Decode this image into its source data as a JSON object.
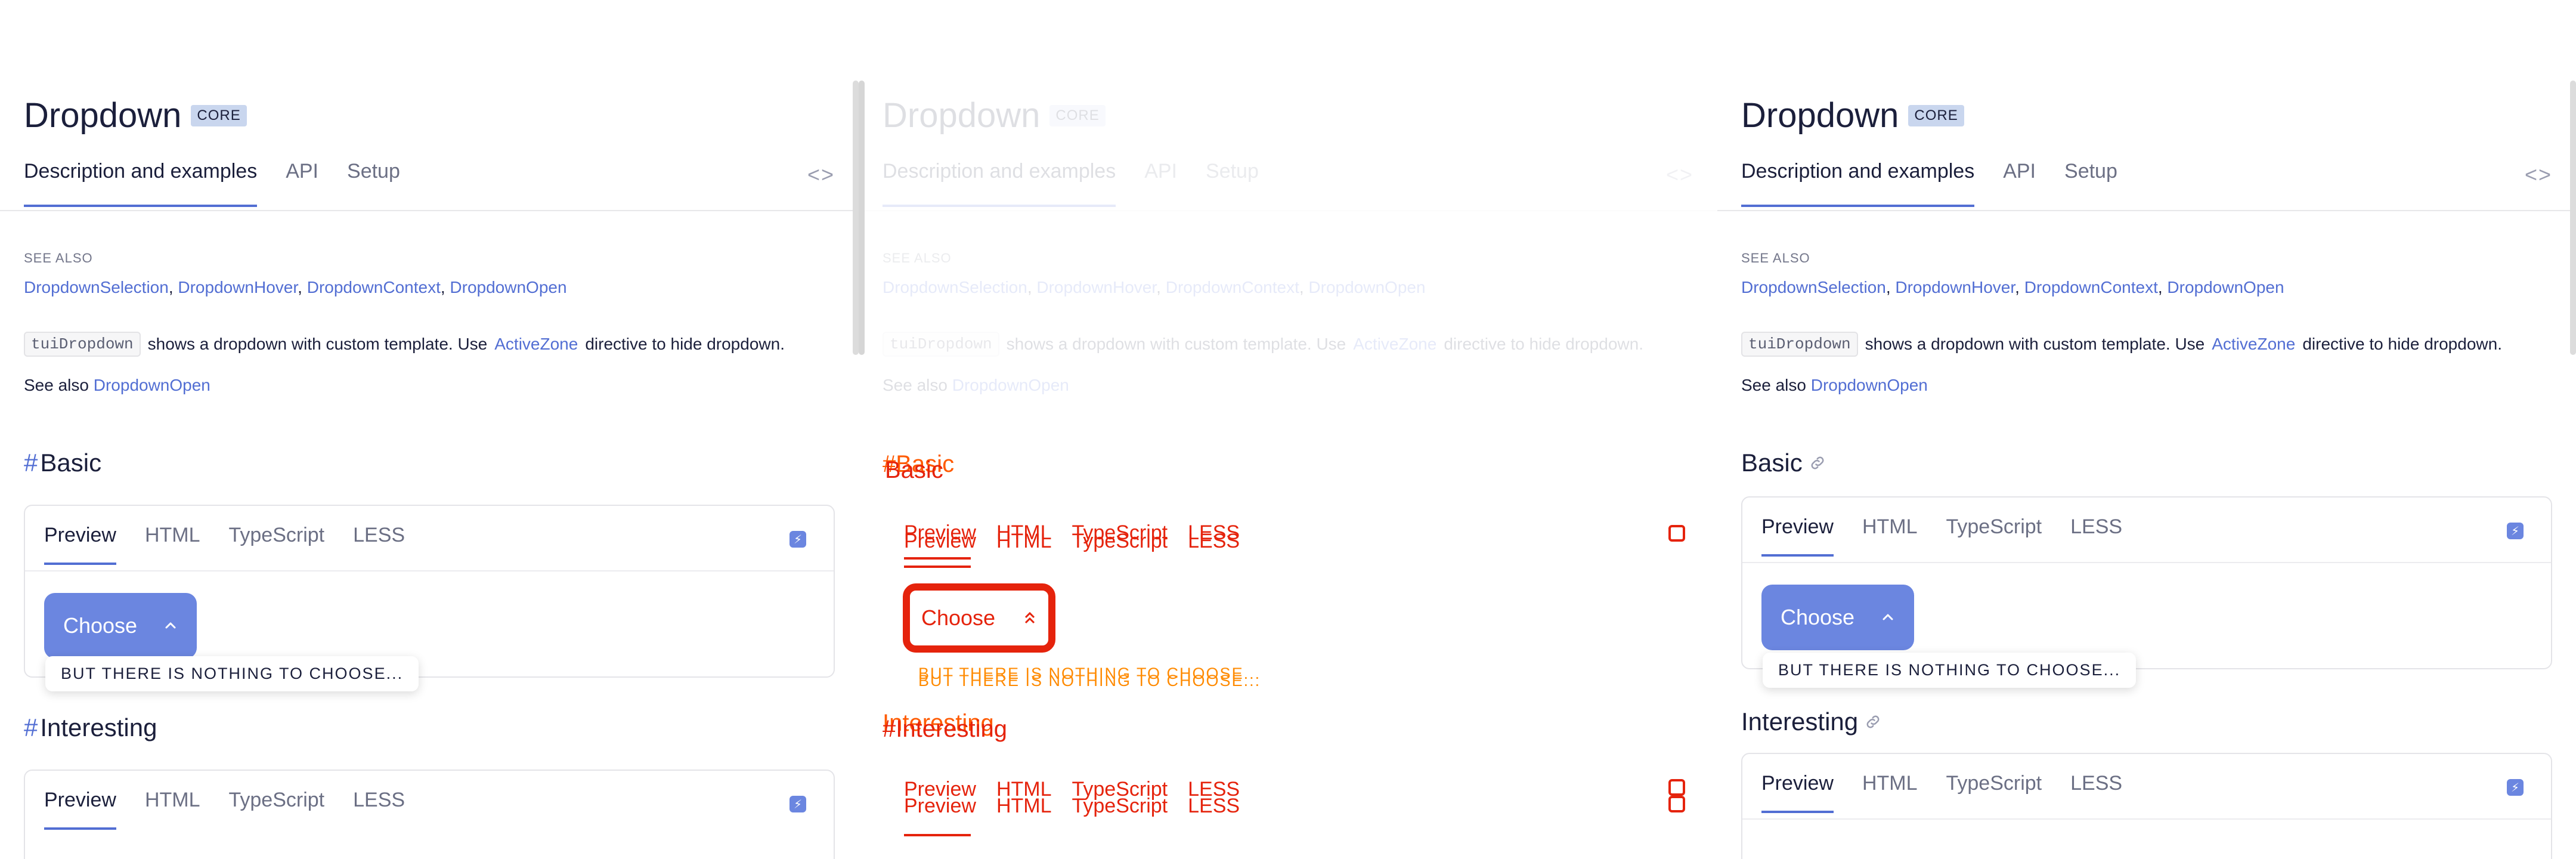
{
  "page": {
    "title": "Dropdown",
    "badge": "CORE",
    "tabs": [
      "Description and examples",
      "API",
      "Setup"
    ],
    "code_toggle": "<>",
    "see_also_label": "SEE ALSO",
    "see_also_links": [
      "DropdownSelection",
      "DropdownHover",
      "DropdownContext",
      "DropdownOpen"
    ],
    "desc_code": "tuiDropdown",
    "desc_text": "shows a dropdown with custom template. Use",
    "desc_link": "ActiveZone",
    "desc_tail": "directive to hide dropdown.",
    "see_also_prefix": "See also",
    "see_also_link": "DropdownOpen"
  },
  "sections": {
    "basic": {
      "hash": "#",
      "title": "Basic"
    },
    "interesting": {
      "hash": "#",
      "title": "Interesting"
    }
  },
  "card": {
    "tabs": [
      "Preview",
      "HTML",
      "TypeScript",
      "LESS"
    ],
    "choose_label": "Choose",
    "dropdown_text": "BUT THERE IS NOTHING TO CHOOSE..."
  },
  "colors": {
    "accent": "#526ed3",
    "button": "#6b86e0",
    "overlay_red": "#e5230c"
  }
}
